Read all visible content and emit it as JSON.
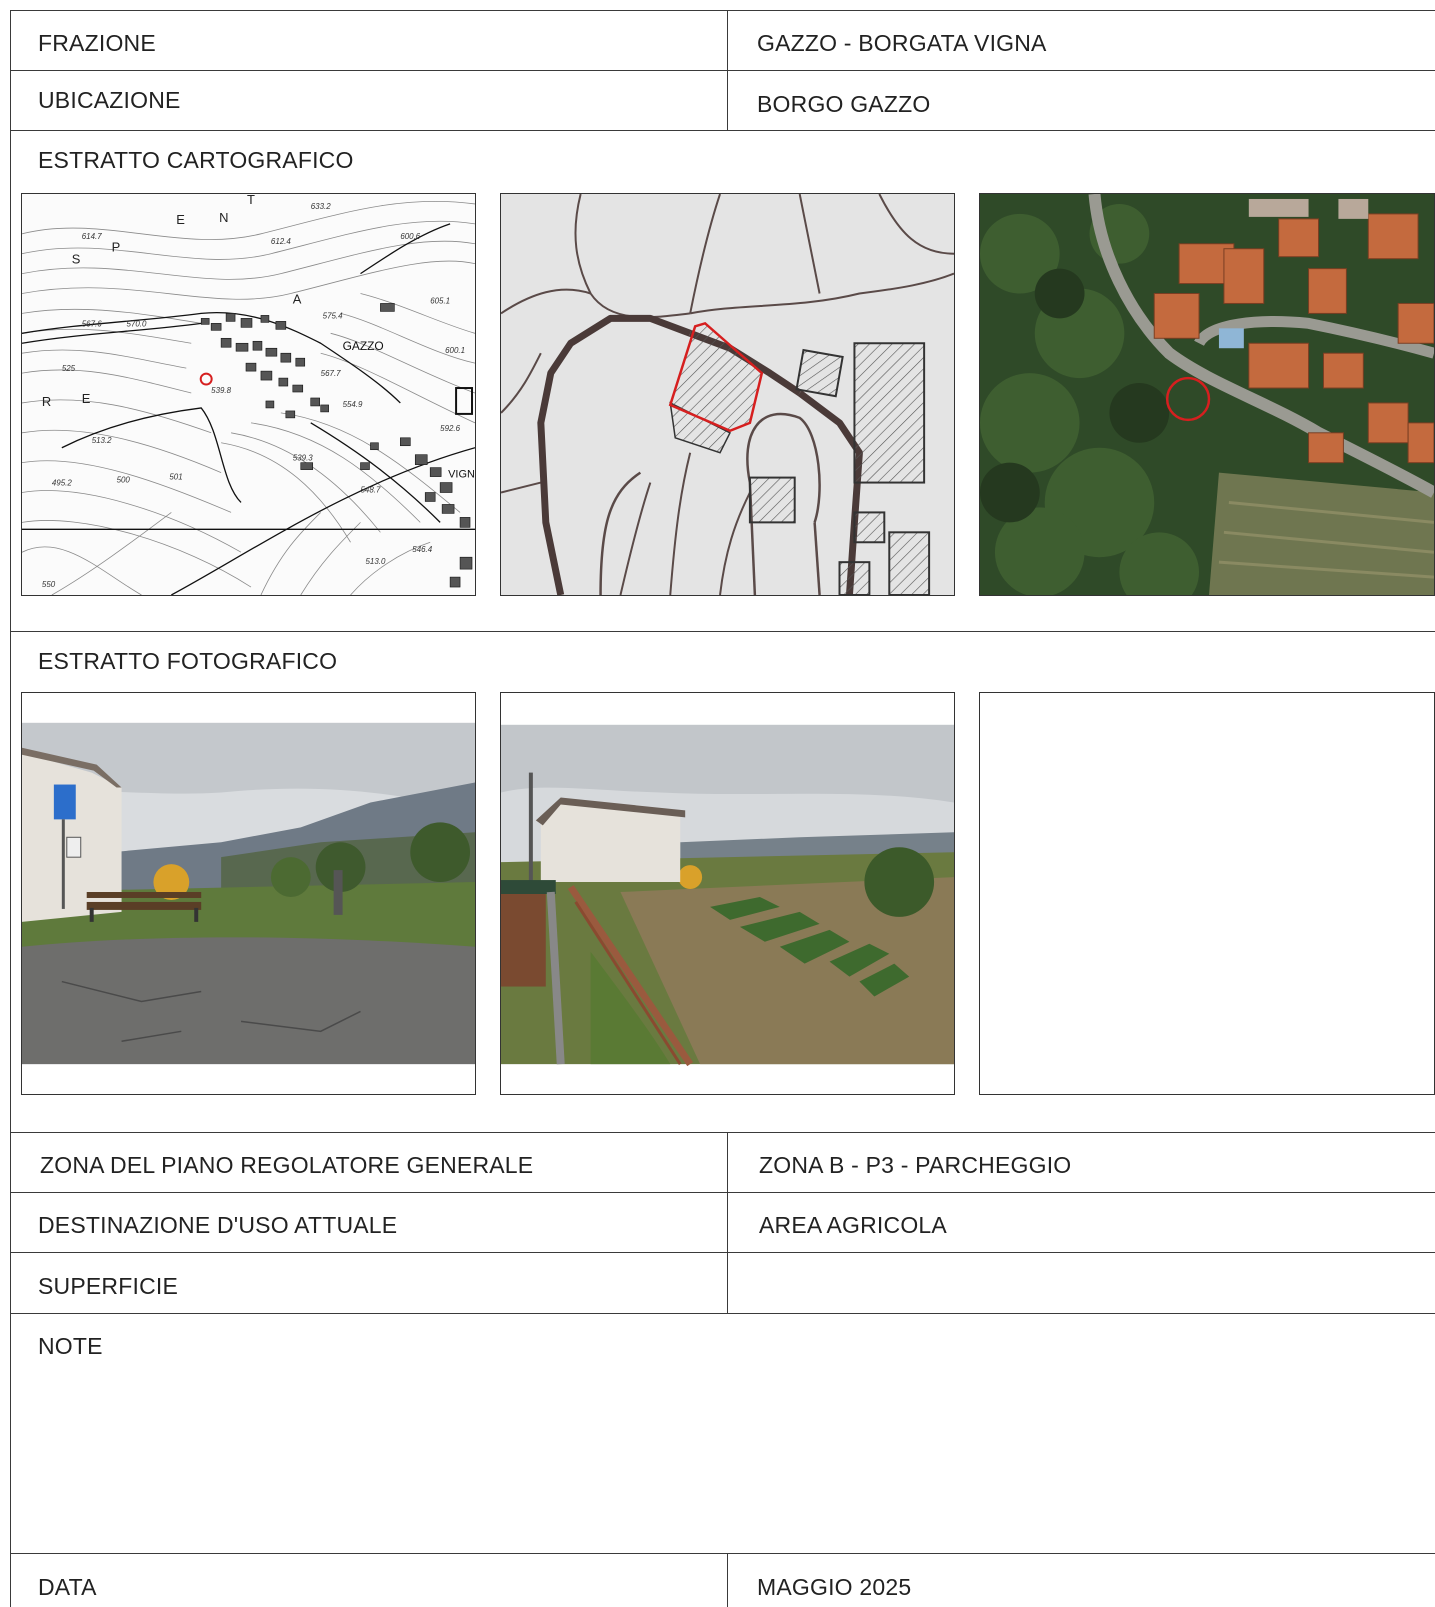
{
  "header": {
    "frazione_label": "FRAZIONE",
    "frazione_value": "GAZZO - BORGATA VIGNA",
    "ubicazione_label": "UBICAZIONE",
    "ubicazione_value": "BORGO GAZZO"
  },
  "cartografico": {
    "title": "ESTRATTO CARTOGRAFICO",
    "topo_labels": {
      "place1": "GAZZO",
      "place2": "VIGN",
      "letters": [
        "S",
        "P",
        "E",
        "N",
        "T",
        "A",
        "R",
        "E"
      ],
      "elevations": [
        "633.2",
        "612.4",
        "614.7",
        "567.6",
        "570.0",
        "575.4",
        "605.1",
        "600.6",
        "600.1",
        "592.6",
        "567.7",
        "554.9",
        "539.3",
        "548.7",
        "525",
        "513.2",
        "500",
        "501",
        "495.2",
        "513.0",
        "546.4",
        "539.8",
        "550"
      ]
    }
  },
  "fotografico": {
    "title": "ESTRATTO FOTOGRAFICO"
  },
  "details": {
    "zona_label": "ZONA DEL PIANO REGOLATORE GENERALE",
    "zona_value": "ZONA B - P3 - PARCHEGGIO",
    "destinazione_label": "DESTINAZIONE D'USO ATTUALE",
    "destinazione_value": "AREA AGRICOLA",
    "superficie_label": "SUPERFICIE",
    "superficie_value": "",
    "note_label": "NOTE",
    "note_value": "",
    "data_label": "DATA",
    "data_value": "MAGGIO 2025"
  },
  "colors": {
    "highlight": "#d61f1f",
    "grid_line": "#3a3a3a"
  }
}
